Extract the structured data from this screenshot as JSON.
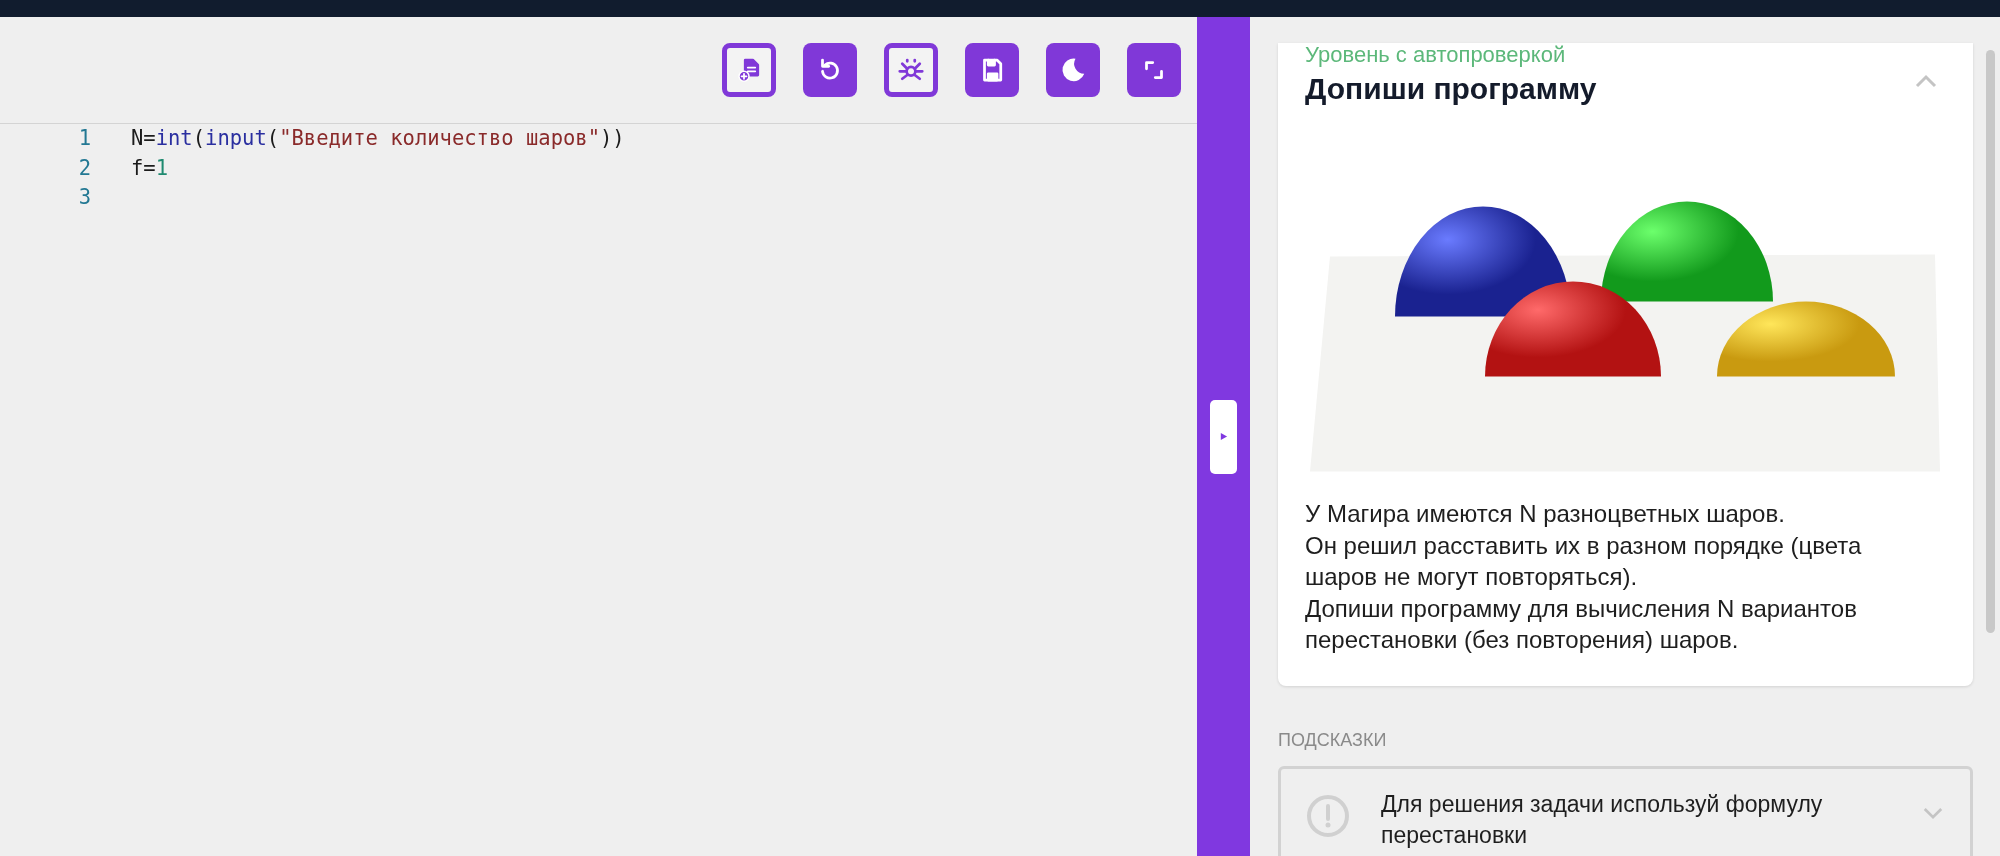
{
  "toolbar": {
    "buttons": [
      {
        "kind": "outlined"
      },
      {
        "kind": "filled"
      },
      {
        "kind": "outlined"
      },
      {
        "kind": "filled"
      },
      {
        "kind": "filled"
      },
      {
        "kind": "filled"
      }
    ]
  },
  "editor": {
    "lines": [
      {
        "number": "1",
        "tokens": [
          {
            "kind": "plain",
            "text": "N="
          },
          {
            "kind": "builtin",
            "text": "int"
          },
          {
            "kind": "plain",
            "text": "("
          },
          {
            "kind": "builtin",
            "text": "input"
          },
          {
            "kind": "plain",
            "text": "("
          },
          {
            "kind": "string",
            "text": "\"Введите количество шаров\""
          },
          {
            "kind": "plain",
            "text": "))"
          }
        ]
      },
      {
        "number": "2",
        "tokens": [
          {
            "kind": "plain",
            "text": "f="
          },
          {
            "kind": "number",
            "text": "1"
          }
        ]
      },
      {
        "number": "3"
      }
    ]
  },
  "task": {
    "level": "Уровень с автопроверкой",
    "title": "Допиши программу",
    "expanded": true,
    "description": [
      "У Магира имеются N разноцветных шаров.",
      "Он решил расставить их в разном порядке (цвета шаров не могут повторяться).",
      "Допиши программу для вычисления N вариантов перестановки (без повторения) шаров."
    ]
  },
  "hints": {
    "heading": "ПОДСКАЗКИ",
    "items": [
      {
        "text": "Для решения задачи используй формулу перестановки",
        "expanded": false
      }
    ]
  }
}
